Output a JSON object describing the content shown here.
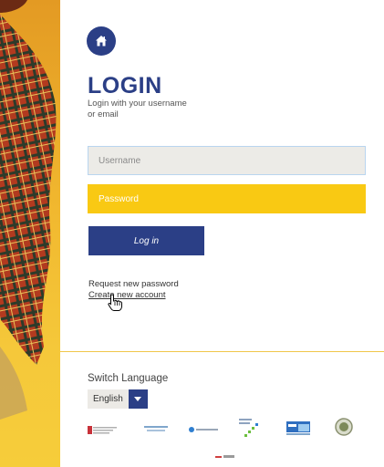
{
  "header": {
    "title": "LOGIN",
    "subtitle": "Login with your username or email"
  },
  "form": {
    "username_placeholder": "Username",
    "password_placeholder": "Password",
    "login_label": "Log in"
  },
  "links": {
    "request_password": "Request new password",
    "create_account": "Create new account"
  },
  "language": {
    "title": "Switch Language",
    "selected": "English"
  },
  "logos": [
    "home-icon-logo",
    "partner-logo-1",
    "partner-logo-2",
    "partner-logo-3",
    "partner-logo-4",
    "fla-logo",
    "seal-logo",
    "bottom-logo"
  ],
  "colors": {
    "primary": "#2b3f86",
    "accent": "#f9c913",
    "input_bg": "#ecebe7",
    "divider": "#f0c64a"
  }
}
